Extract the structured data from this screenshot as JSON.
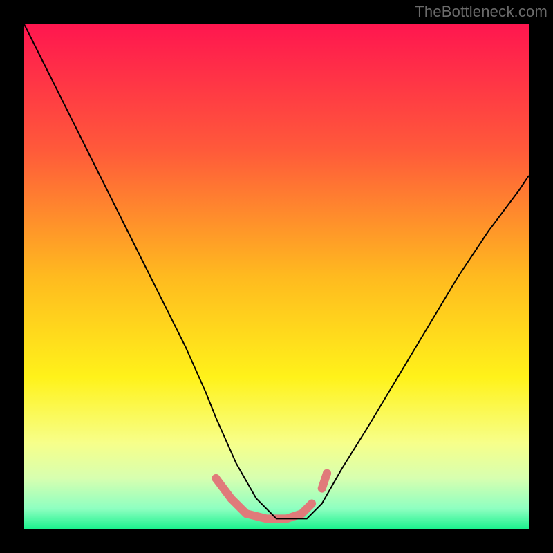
{
  "watermark": "TheBottleneck.com",
  "chart_data": {
    "type": "line",
    "title": "",
    "xlabel": "",
    "ylabel": "",
    "xlim": [
      0,
      100
    ],
    "ylim": [
      0,
      100
    ],
    "grid": false,
    "gradient_background": {
      "stops": [
        {
          "pos": 0.0,
          "color": "#ff164f"
        },
        {
          "pos": 0.25,
          "color": "#ff5a3a"
        },
        {
          "pos": 0.5,
          "color": "#ffba1f"
        },
        {
          "pos": 0.7,
          "color": "#fff21a"
        },
        {
          "pos": 0.83,
          "color": "#f7ff8a"
        },
        {
          "pos": 0.9,
          "color": "#d7ffb0"
        },
        {
          "pos": 0.96,
          "color": "#8effc1"
        },
        {
          "pos": 1.0,
          "color": "#1cf28e"
        }
      ]
    },
    "series": [
      {
        "name": "bottleneck-curve",
        "x": [
          0,
          2,
          5,
          8,
          12,
          16,
          20,
          24,
          28,
          32,
          36,
          38,
          42,
          46,
          50,
          54,
          56,
          59,
          63,
          68,
          74,
          80,
          86,
          92,
          98,
          100
        ],
        "y": [
          100,
          96,
          90,
          84,
          76,
          68,
          60,
          52,
          44,
          36,
          27,
          22,
          13,
          6,
          2,
          2,
          2,
          5,
          12,
          20,
          30,
          40,
          50,
          59,
          67,
          70
        ],
        "stroke": "#000000",
        "stroke_width": 2
      }
    ],
    "markers": [
      {
        "name": "valley-marker",
        "color": "#e07a7a",
        "thickness": 12,
        "points_xy": [
          [
            38,
            10
          ],
          [
            41,
            6
          ],
          [
            44,
            3
          ],
          [
            48,
            2
          ],
          [
            52,
            2
          ],
          [
            55,
            3
          ],
          [
            57,
            5
          ],
          [
            59,
            8
          ],
          [
            60,
            11
          ]
        ],
        "gap_after_index": 6
      }
    ]
  }
}
